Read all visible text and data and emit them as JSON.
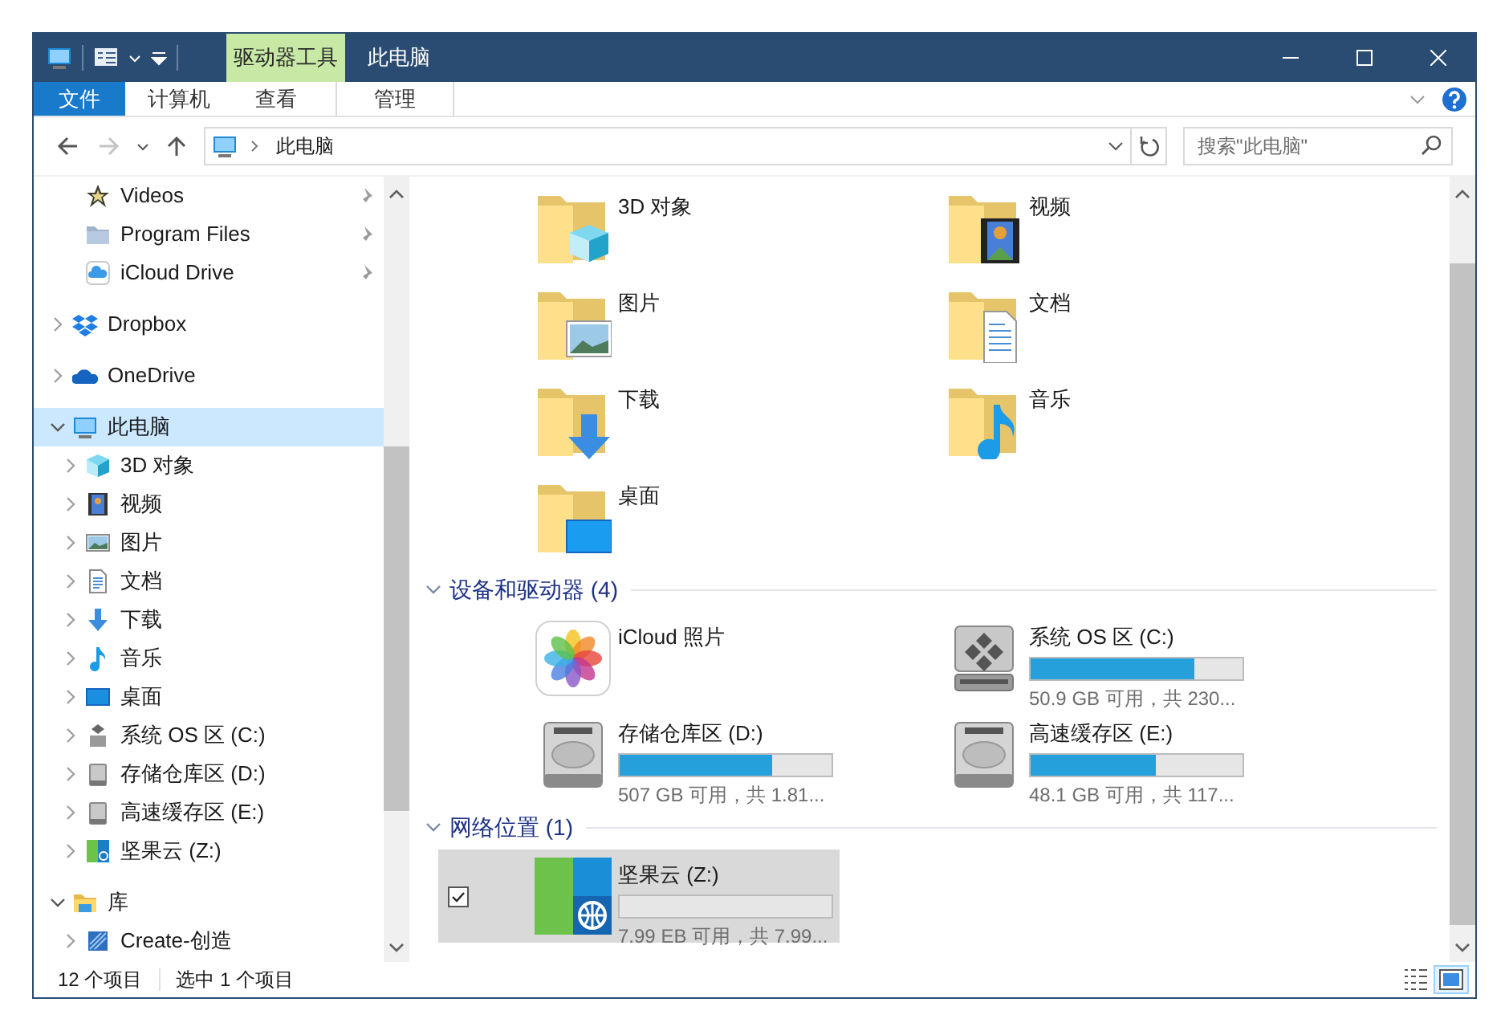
{
  "title_bar": {
    "contextual_tab": "驱动器工具",
    "title": "此电脑"
  },
  "ribbon_tabs": [
    {
      "label": "文件",
      "kind": "file",
      "selected": false
    },
    {
      "label": "计算机",
      "kind": "tab",
      "selected": false
    },
    {
      "label": "查看",
      "kind": "tab",
      "selected": false
    },
    {
      "label": "管理",
      "kind": "contextual",
      "selected": false
    }
  ],
  "nav_buttons": [
    {
      "kind": "back",
      "disabled": false
    },
    {
      "kind": "forward",
      "disabled": true
    },
    {
      "kind": "recent",
      "disabled": false
    },
    {
      "kind": "up",
      "disabled": false
    }
  ],
  "address_bar": {
    "location": "此电脑"
  },
  "search": {
    "placeholder": "搜索\"此电脑\""
  },
  "nav_pane": {
    "pinned": [
      {
        "label": "Videos",
        "kind": "videos",
        "pinned": true,
        "selected": false
      },
      {
        "label": "Program Files",
        "kind": "folder",
        "pinned": true,
        "selected": false
      },
      {
        "label": "iCloud Drive",
        "kind": "cloud",
        "pinned": true,
        "selected": false
      }
    ],
    "tree": [
      {
        "label": "Dropbox",
        "kind": "dropbox",
        "expanded": false,
        "selected": false
      },
      {
        "label": "OneDrive",
        "kind": "onedrive",
        "expanded": false,
        "selected": false
      },
      {
        "label": "此电脑",
        "kind": "pc",
        "expanded": true,
        "selected": true,
        "children": [
          {
            "label": "3D 对象",
            "kind": "cube",
            "expanded": false,
            "selected": false
          },
          {
            "label": "视频",
            "kind": "video",
            "expanded": false,
            "selected": false
          },
          {
            "label": "图片",
            "kind": "pictures",
            "expanded": false,
            "selected": false
          },
          {
            "label": "文档",
            "kind": "documents",
            "expanded": false,
            "selected": false
          },
          {
            "label": "下载",
            "kind": "downloads",
            "expanded": false,
            "selected": false
          },
          {
            "label": "音乐",
            "kind": "music",
            "expanded": false,
            "selected": false
          },
          {
            "label": "桌面",
            "kind": "desktop",
            "expanded": false,
            "selected": false
          },
          {
            "label": "系统 OS 区 (C:)",
            "kind": "os-drive",
            "expanded": false,
            "selected": false
          },
          {
            "label": "存储仓库区 (D:)",
            "kind": "drive",
            "expanded": false,
            "selected": false
          },
          {
            "label": "高速缓存区 (E:)",
            "kind": "drive",
            "expanded": false,
            "selected": false
          },
          {
            "label": "坚果云 (Z:)",
            "kind": "network",
            "expanded": false,
            "selected": false
          }
        ]
      },
      {
        "label": "库",
        "kind": "library",
        "expanded": true,
        "selected": false,
        "children": [
          {
            "label": "Create-创造",
            "kind": "library-folder",
            "expanded": false,
            "selected": false
          }
        ]
      }
    ]
  },
  "content": {
    "groups": [
      {
        "items": [
          {
            "name": "3D 对象",
            "kind": "cube",
            "selected": false,
            "checked": false
          },
          {
            "name": "视频",
            "kind": "video",
            "selected": false,
            "checked": false
          },
          {
            "name": "图片",
            "kind": "pictures",
            "selected": false,
            "checked": false
          },
          {
            "name": "文档",
            "kind": "documents",
            "selected": false,
            "checked": false
          },
          {
            "name": "下载",
            "kind": "downloads",
            "selected": false,
            "checked": false
          },
          {
            "name": "音乐",
            "kind": "music",
            "selected": false,
            "checked": false
          },
          {
            "name": "桌面",
            "kind": "desktop",
            "selected": false,
            "checked": false
          }
        ]
      },
      {
        "title": "设备和驱动器 (4)",
        "expanded": true,
        "items": [
          {
            "name": "iCloud 照片",
            "kind": "photos-app",
            "selected": false,
            "checked": false
          },
          {
            "name": "系统 OS 区 (C:)",
            "kind": "os-drive",
            "level": 0.77,
            "free": "50.9 GB 可用，共 230...",
            "selected": false,
            "checked": false
          },
          {
            "name": "存储仓库区 (D:)",
            "kind": "drive",
            "level": 0.72,
            "free": "507 GB 可用，共 1.81...",
            "selected": false,
            "checked": false
          },
          {
            "name": "高速缓存区 (E:)",
            "kind": "drive",
            "level": 0.59,
            "free": "48.1 GB 可用，共 117...",
            "selected": false,
            "checked": false
          }
        ]
      },
      {
        "title": "网络位置 (1)",
        "expanded": true,
        "items": [
          {
            "name": "坚果云 (Z:)",
            "kind": "network",
            "level": 0,
            "free": "7.99 EB 可用，共 7.99...",
            "selected": true,
            "checked": true
          }
        ]
      }
    ]
  },
  "status_bar": {
    "item_count": "12 个项目",
    "selection": "选中 1 个项目",
    "views": [
      {
        "kind": "details",
        "selected": false
      },
      {
        "kind": "large-icons",
        "selected": true
      }
    ]
  }
}
